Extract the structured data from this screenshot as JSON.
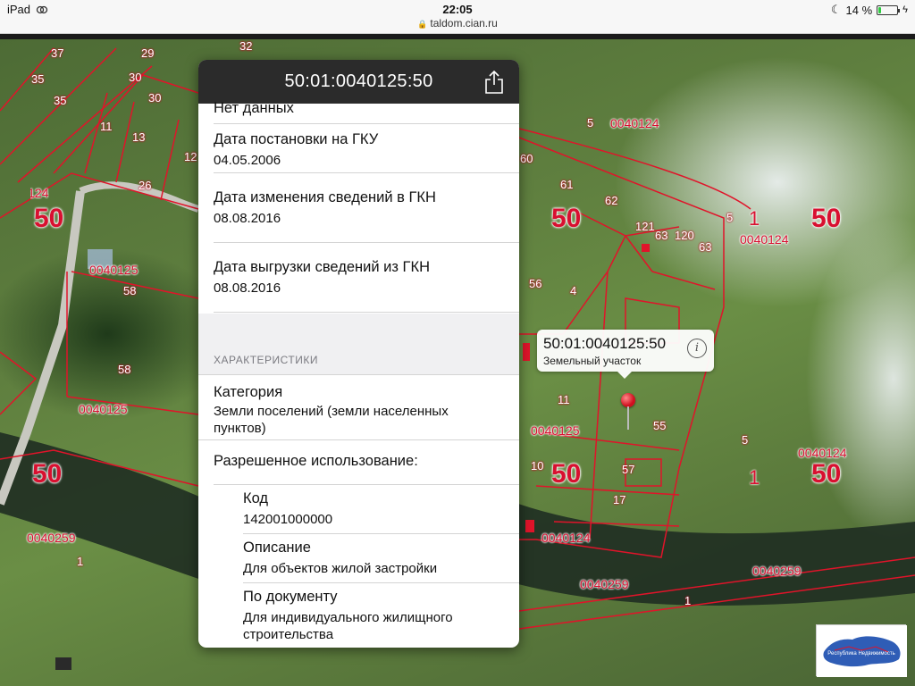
{
  "status_bar": {
    "device": "iPad",
    "time": "22:05",
    "url": "taldom.cian.ru",
    "battery_percent": "14 %",
    "battery_level": 0.14
  },
  "map": {
    "labels": {
      "big50": [
        "50",
        "50",
        "50",
        "50",
        "50",
        "50"
      ],
      "big1": [
        "1",
        "1"
      ],
      "cadastral": [
        "0040125",
        "0040125",
        "0040125",
        "0040124",
        "0040124",
        "0040124",
        "0040124",
        "0040259",
        "0040259",
        "0040259",
        "0040124"
      ],
      "parcels": [
        "37",
        "29",
        "32",
        "35",
        "30",
        "35",
        "30",
        "11",
        "13",
        "12",
        "26",
        "58",
        "58",
        "60",
        "61",
        "62",
        "121",
        "63",
        "120",
        "63",
        "56",
        "4",
        "11",
        "10",
        "55",
        "57",
        "17",
        "5",
        "5",
        "5",
        "1",
        "1"
      ]
    },
    "callout": {
      "title": "50:01:0040125:50",
      "subtitle": "Земельный участок",
      "info_icon": "info-icon"
    },
    "logo_text": "Республика Недвижимость"
  },
  "panel": {
    "header_title": "50:01:0040125:50",
    "share_icon": "share-icon",
    "top_value": "Нет данных",
    "rows": [
      {
        "label": "Дата постановки на ГКУ",
        "value": "04.05.2006"
      },
      {
        "label": "Дата изменения сведений в ГКН",
        "value": "08.08.2016"
      },
      {
        "label": "Дата выгрузки сведений из ГКН",
        "value": "08.08.2016"
      }
    ],
    "section_title": "ХАРАКТЕРИСТИКИ",
    "category": {
      "label": "Категория",
      "value": "Земли поселений (земли населенных пунктов)"
    },
    "permitted_use": {
      "label": "Разрешенное использование:"
    },
    "sub_rows": [
      {
        "label": "Код",
        "value": "142001000000"
      },
      {
        "label": "Описание",
        "value": "Для объектов жилой застройки"
      },
      {
        "label": "По документу",
        "value": "Для индивидуального жилищного строительства"
      }
    ]
  }
}
